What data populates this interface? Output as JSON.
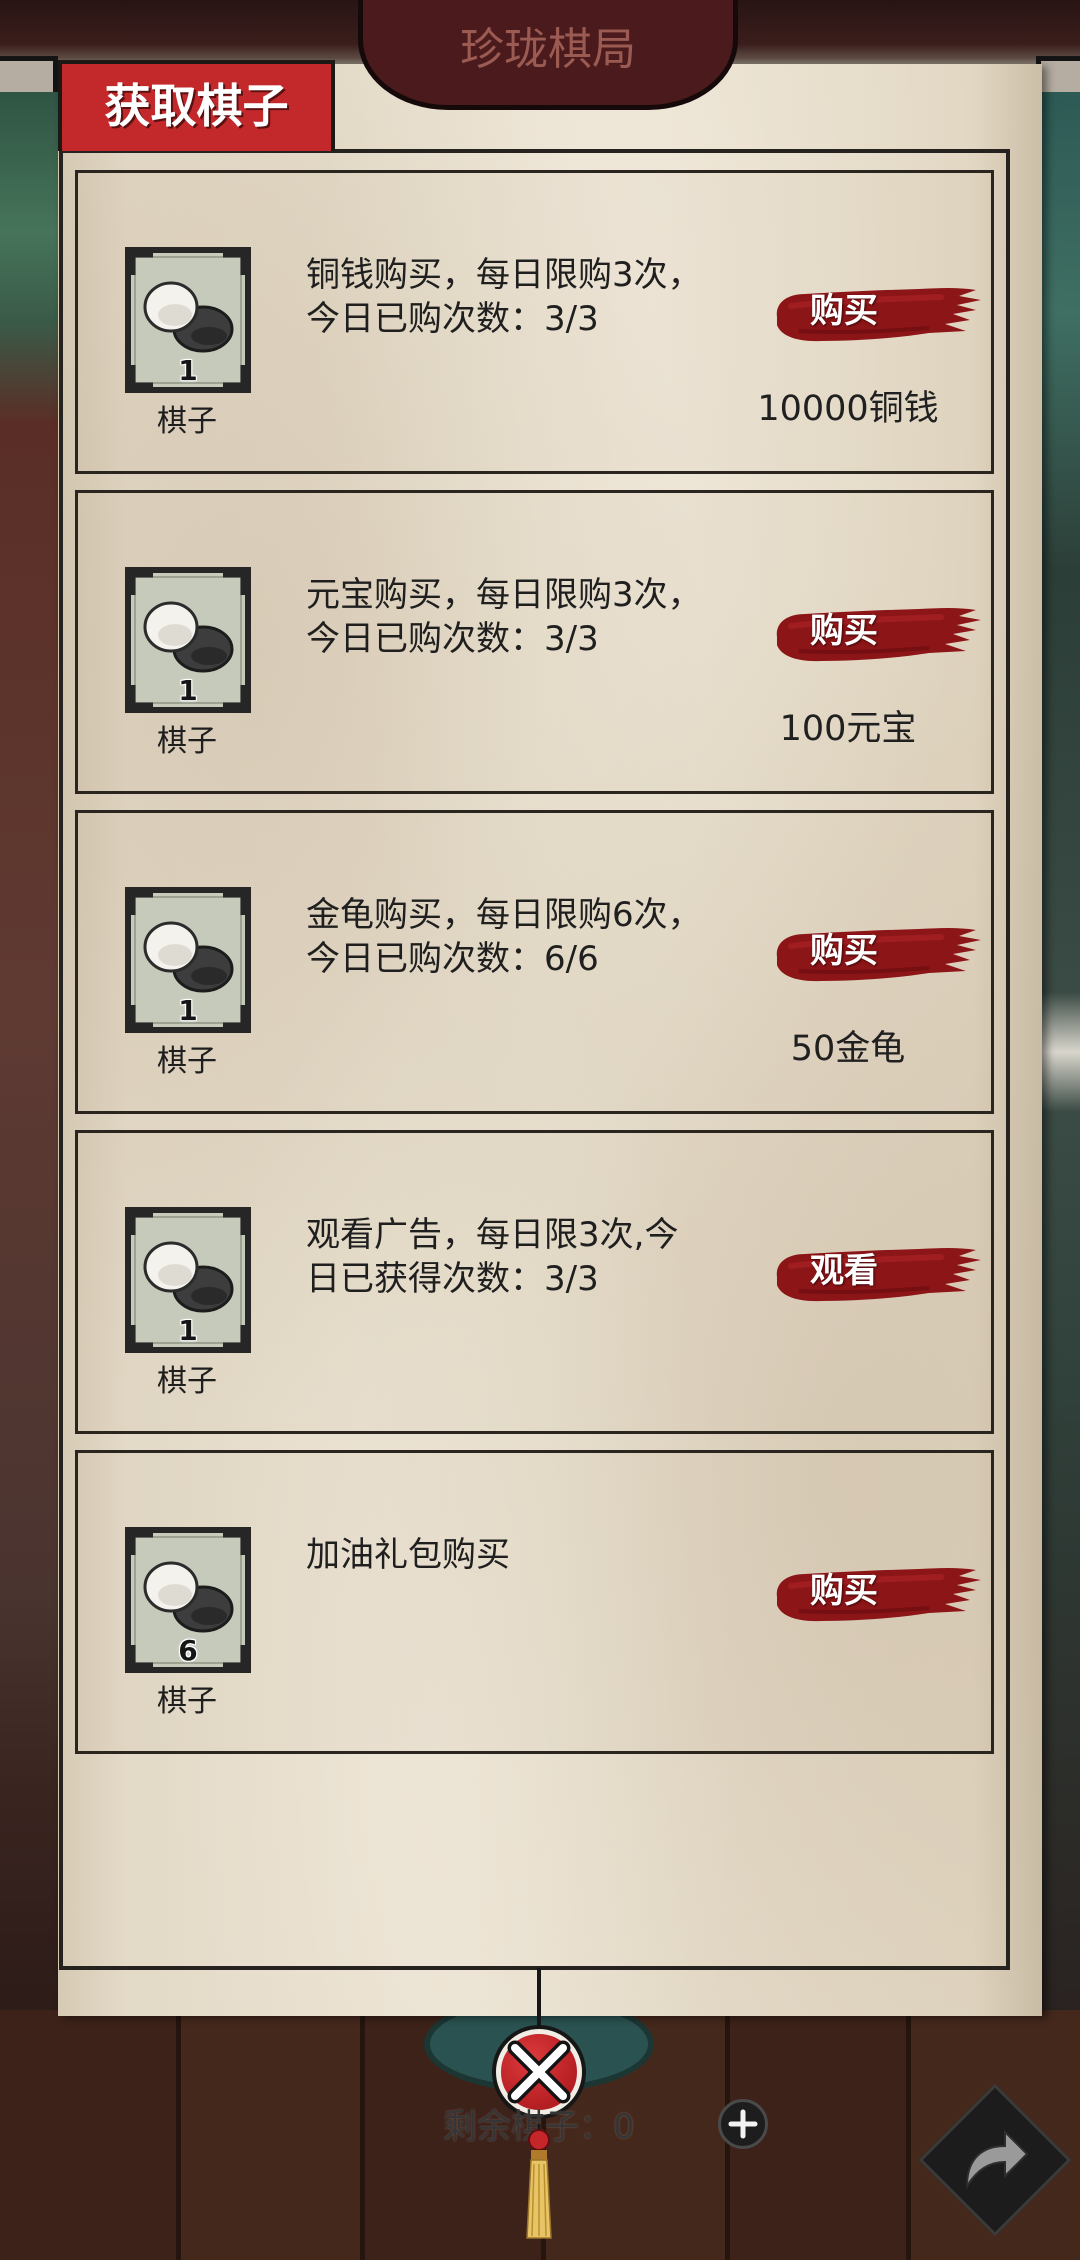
{
  "header": {
    "title": "珍珑棋局"
  },
  "panel": {
    "tab_label": "获取棋子"
  },
  "items": [
    {
      "icon": "go-stones-icon",
      "quantity": "1",
      "label": "棋子",
      "desc_lines": [
        "铜钱购买，每日限购3次，",
        "今日已购次数：3/3"
      ],
      "button_label": "购买",
      "price": "10000铜钱"
    },
    {
      "icon": "go-stones-icon",
      "quantity": "1",
      "label": "棋子",
      "desc_lines": [
        "元宝购买，每日限购3次，",
        "今日已购次数：3/3"
      ],
      "button_label": "购买",
      "price": "100元宝"
    },
    {
      "icon": "go-stones-icon",
      "quantity": "1",
      "label": "棋子",
      "desc_lines": [
        "金龟购买，每日限购6次，",
        "今日已购次数：6/6"
      ],
      "button_label": "购买",
      "price": "50金龟"
    },
    {
      "icon": "go-stones-icon",
      "quantity": "1",
      "label": "棋子",
      "desc_lines": [
        "观看广告，每日限3次,今",
        "日已获得次数：3/3"
      ],
      "button_label": "观看"
    },
    {
      "icon": "go-stones-icon",
      "quantity": "6",
      "label": "棋子",
      "desc_lines": [
        "加油礼包购买"
      ],
      "button_label": "购买"
    }
  ],
  "footer": {
    "remaining_label": "剩余棋子：",
    "remaining_count": "0",
    "icons": [
      "close-icon",
      "tassel-icon",
      "plus-icon",
      "share-arrow-icon"
    ]
  },
  "colors": {
    "tab_red": "#c3292b",
    "button_red": "#8c1518",
    "parchment": "#e6dcca",
    "banner": "#4a1a1c",
    "icon_tile": "#c5cabb"
  }
}
